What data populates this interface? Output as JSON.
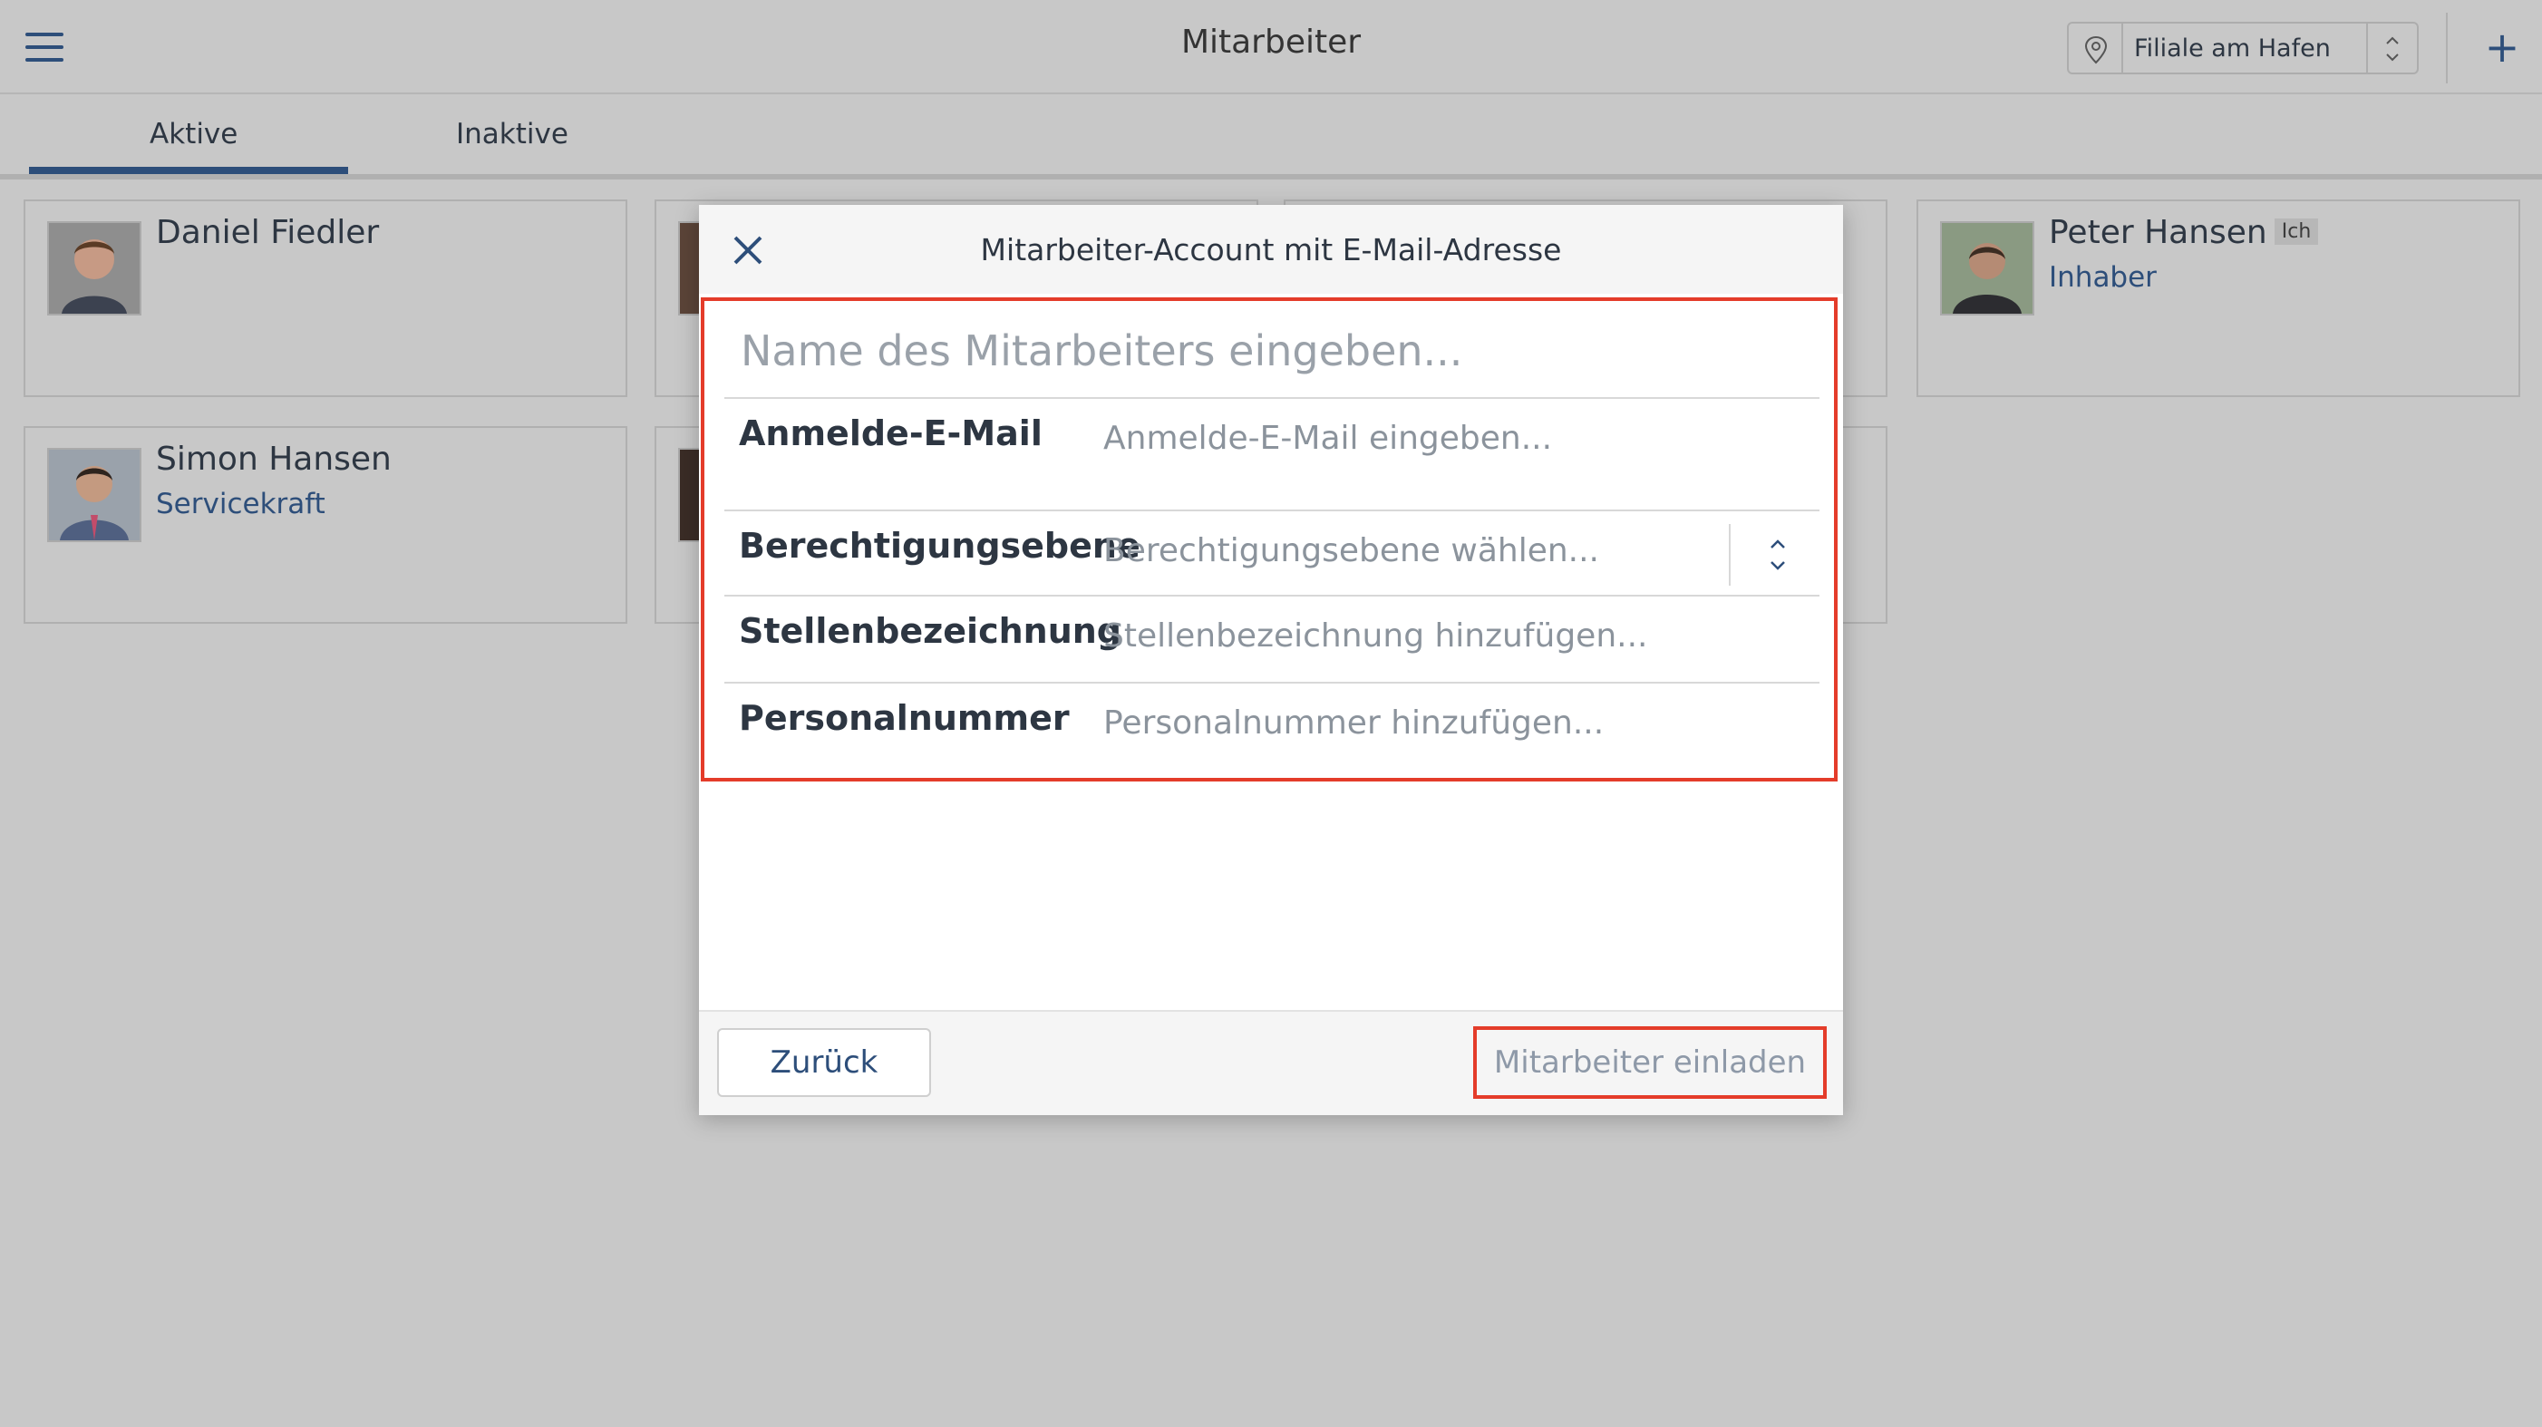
{
  "header": {
    "title": "Mitarbeiter",
    "location": "Filiale am Hafen"
  },
  "tabs": [
    {
      "label": "Aktive",
      "active": true
    },
    {
      "label": "Inaktive",
      "active": false
    }
  ],
  "employees": [
    {
      "name": "Daniel Fiedler",
      "role": ""
    },
    {
      "name": "Peter Hansen",
      "role": "Inhaber",
      "badge": "Ich"
    },
    {
      "name": "Simon Hansen",
      "role": "Servicekraft"
    }
  ],
  "modal": {
    "title": "Mitarbeiter-Account mit E-Mail-Adresse",
    "name_placeholder": "Name des Mitarbeiters eingeben...",
    "fields": [
      {
        "label": "Anmelde-E-Mail",
        "placeholder": "Anmelde-E-Mail eingeben..."
      },
      {
        "label": "Berechtigungsebene",
        "placeholder": "Berechtigungsebene wählen..."
      },
      {
        "label": "Stellenbezeichnung",
        "placeholder": "Stellenbezeichnung hinzufügen..."
      },
      {
        "label": "Personalnummer",
        "placeholder": "Personalnummer hinzufügen..."
      }
    ],
    "back_label": "Zurück",
    "invite_label": "Mitarbeiter einladen"
  },
  "colors": {
    "accent": "#2d4e7a",
    "highlight": "#e43c2a",
    "overlay": "#c8c8c8"
  }
}
